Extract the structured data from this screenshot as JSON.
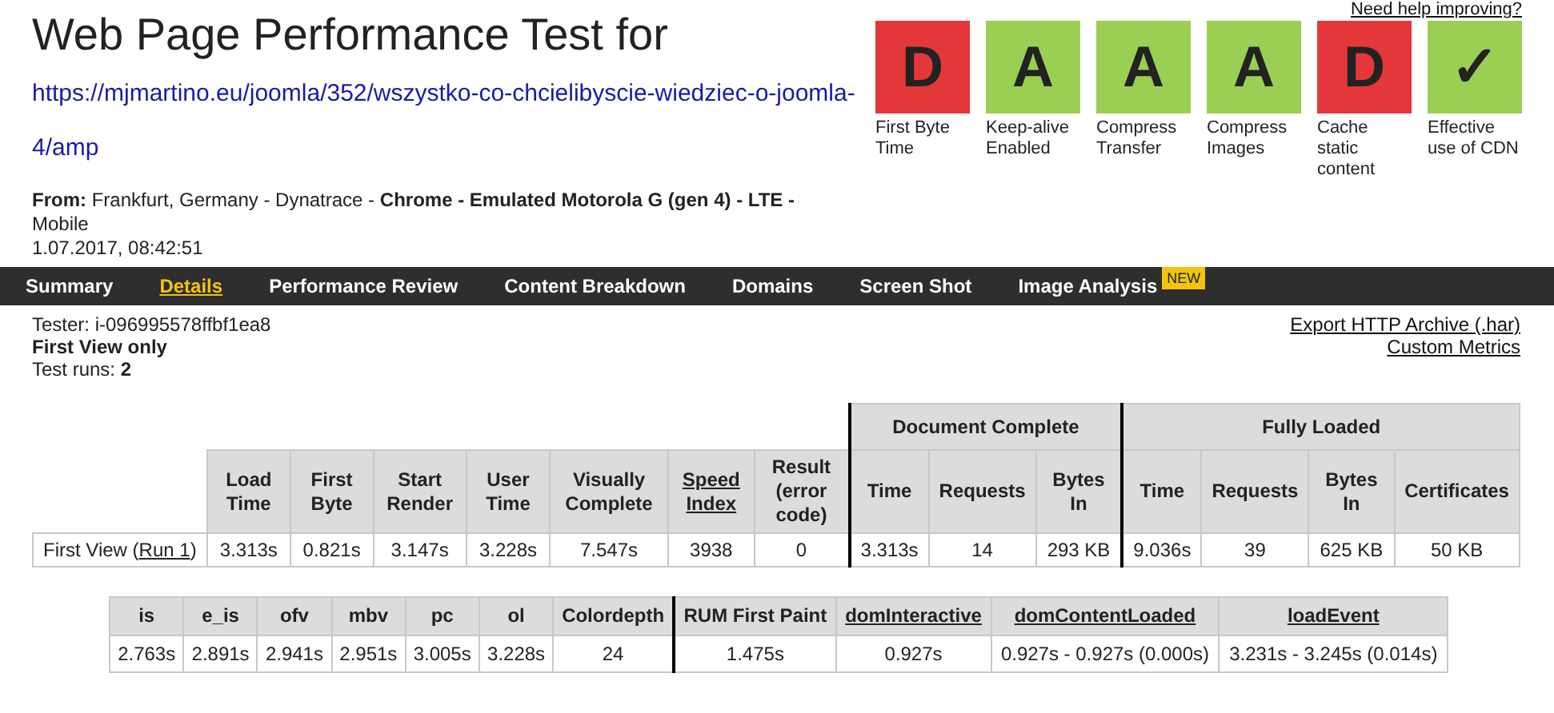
{
  "header": {
    "title": "Web Page Performance Test for",
    "url": "https://mjmartino.eu/joomla/352/wszystko-co-chcielibyscie-wiedziec-o-joomla-4/amp",
    "from_label": "From:",
    "from_location": "Frankfurt, Germany - Dynatrace -",
    "from_browser": "Chrome - Emulated Motorola G (gen 4) - LTE -",
    "from_device": "Mobile",
    "date": "1.07.2017, 08:42:51"
  },
  "help_link": "Need help improving?",
  "grades": [
    {
      "grade": "D",
      "label": "First Byte Time",
      "color": "#e4373a"
    },
    {
      "grade": "A",
      "label": "Keep-alive Enabled",
      "color": "#9bcf53"
    },
    {
      "grade": "A",
      "label": "Compress Transfer",
      "color": "#9bcf53"
    },
    {
      "grade": "A",
      "label": "Compress Images",
      "color": "#9bcf53"
    },
    {
      "grade": "D",
      "label": "Cache static content",
      "color": "#e4373a"
    },
    {
      "grade": "✓",
      "label": "Effective use of CDN",
      "color": "#9bcf53"
    }
  ],
  "tabs": [
    {
      "label": "Summary",
      "selected": false
    },
    {
      "label": "Details",
      "selected": true
    },
    {
      "label": "Performance Review",
      "selected": false
    },
    {
      "label": "Content Breakdown",
      "selected": false
    },
    {
      "label": "Domains",
      "selected": false
    },
    {
      "label": "Screen Shot",
      "selected": false
    },
    {
      "label": "Image Analysis",
      "selected": false,
      "badge": "NEW"
    }
  ],
  "info": {
    "tester": "Tester: i-096995578ffbf1ea8",
    "view": "First View only",
    "runs_label": "Test runs:",
    "runs": "2"
  },
  "links": [
    "Export HTTP Archive (.har)",
    "Custom Metrics"
  ],
  "main_table": {
    "columns": [
      {
        "label": "Load Time",
        "link": false
      },
      {
        "label": "First Byte",
        "link": false
      },
      {
        "label": "Start Render",
        "link": false
      },
      {
        "label": "User Time",
        "link": false
      },
      {
        "label": "Visually Complete",
        "link": false
      },
      {
        "label": "Speed Index",
        "link": true
      },
      {
        "label": "Result (error code)",
        "link": false
      }
    ],
    "groups": [
      {
        "label": "Document Complete",
        "columns": [
          {
            "label": "Time",
            "link": false
          },
          {
            "label": "Requests",
            "link": false
          },
          {
            "label": "Bytes In",
            "link": false
          }
        ]
      },
      {
        "label": "Fully Loaded",
        "columns": [
          {
            "label": "Time",
            "link": false
          },
          {
            "label": "Requests",
            "link": false
          },
          {
            "label": "Bytes In",
            "link": false
          },
          {
            "label": "Certificates",
            "link": false
          }
        ]
      }
    ],
    "rows": [
      {
        "prefix": "First View (",
        "link": "Run 1",
        "suffix": ")",
        "cells": [
          "3.313s",
          "0.821s",
          "3.147s",
          "3.228s",
          "7.547s",
          "3938",
          "0",
          "3.313s",
          "14",
          "293 KB",
          "9.036s",
          "39",
          "625 KB",
          "50 KB"
        ]
      }
    ]
  },
  "rum_table": {
    "sections": [
      {
        "columns": [
          {
            "label": "is",
            "link": false
          },
          {
            "label": "e_is",
            "link": false
          },
          {
            "label": "ofv",
            "link": false
          },
          {
            "label": "mbv",
            "link": false
          },
          {
            "label": "pc",
            "link": false
          },
          {
            "label": "ol",
            "link": false
          },
          {
            "label": "Colordepth",
            "link": false
          }
        ]
      },
      {
        "columns": [
          {
            "label": "RUM First Paint",
            "link": false
          },
          {
            "label": "domInteractive",
            "link": true
          },
          {
            "label": "domContentLoaded",
            "link": true
          },
          {
            "label": "loadEvent",
            "link": true
          }
        ]
      }
    ],
    "rows": [
      [
        "2.763s",
        "2.891s",
        "2.941s",
        "2.951s",
        "3.005s",
        "3.228s",
        "24",
        "1.475s",
        "0.927s",
        "0.927s - 0.927s (0.000s)",
        "3.231s - 3.245s (0.014s)"
      ]
    ]
  }
}
